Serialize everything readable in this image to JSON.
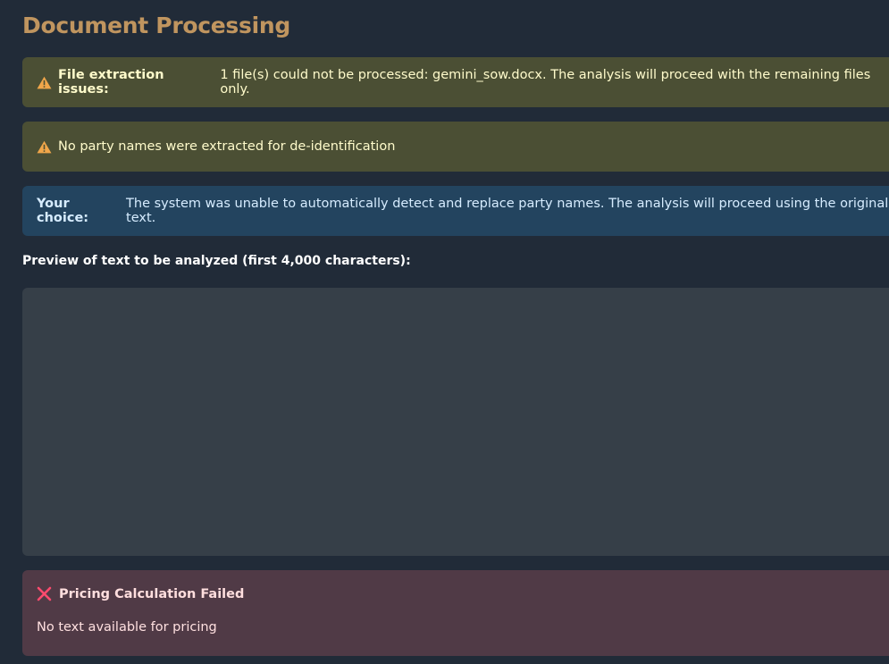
{
  "page": {
    "title": "Document Processing"
  },
  "alerts": {
    "extraction": {
      "type": "warning",
      "icon": "warning-icon",
      "bold": "File extraction issues:",
      "text": "1 file(s) could not be processed: gemini_sow.docx. The analysis will proceed with the remaining files only."
    },
    "party_names": {
      "type": "warning",
      "icon": "warning-icon",
      "text": "No party names were extracted for de-identification"
    },
    "choice": {
      "type": "info",
      "bold": "Your choice:",
      "text": "The system was unable to automatically detect and replace party names. The analysis will proceed using the original text."
    }
  },
  "preview": {
    "label": "Preview of text to be analyzed (first 4,000 characters):",
    "value": ""
  },
  "error": {
    "icon": "x-icon",
    "title": "Pricing Calculation Failed",
    "message": "No text available for pricing"
  },
  "colors": {
    "background": "#212b38",
    "title": "#c0955f",
    "warning_bg": "#4b4f34",
    "warning_icon": "#f0a64a",
    "info_bg": "#23445f",
    "textarea_bg": "#363f48",
    "error_bg": "#503a46",
    "error_icon": "#ff4b6e"
  }
}
